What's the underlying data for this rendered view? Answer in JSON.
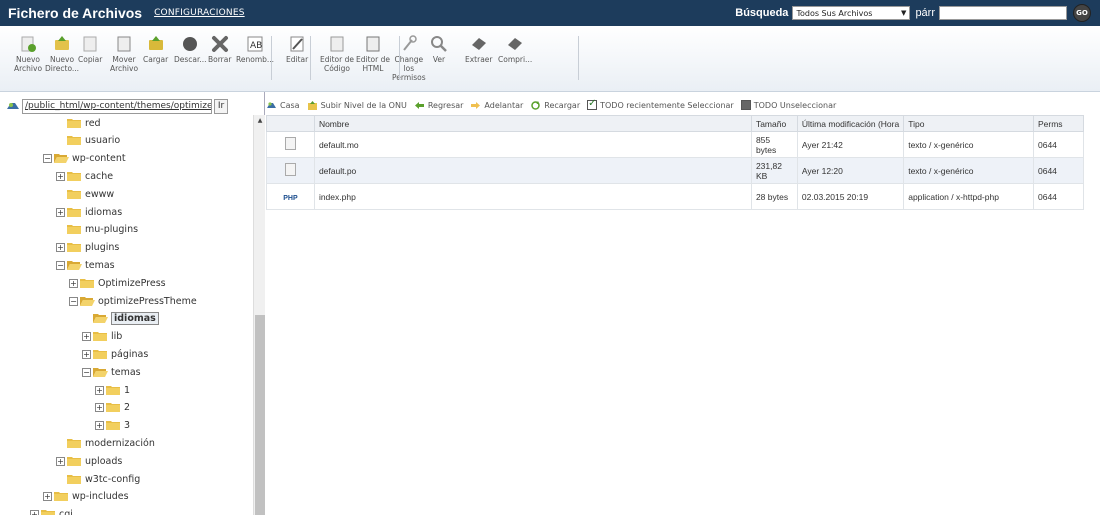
{
  "header": {
    "title": "Fichero de Archivos",
    "config_link": "CONFIGURACIONES",
    "search_label": "Búsqueda",
    "search_scope": "Todos Sus Archivos",
    "search_by_label": "párr",
    "search_value": "",
    "go_label": "GO"
  },
  "toolbar": {
    "items": [
      {
        "label": "Nuevo\nArchivo",
        "icon": "new-file-icon"
      },
      {
        "label": "Nuevo\nDirecto...",
        "icon": "new-folder-icon"
      },
      {
        "label": "Copiar",
        "icon": "copy-icon"
      },
      {
        "label": "Mover\nArchivo",
        "icon": "move-icon"
      },
      {
        "label": "Cargar",
        "icon": "upload-icon"
      },
      {
        "label": "Descar...",
        "icon": "download-icon"
      },
      {
        "label": "Borrar",
        "icon": "delete-icon"
      },
      {
        "label": "Renomb...",
        "icon": "rename-icon"
      },
      {
        "label": "Editar",
        "icon": "edit-icon"
      },
      {
        "label": "Editor de\nCódigo",
        "icon": "code-editor-icon"
      },
      {
        "label": "Editor de\nHTML",
        "icon": "html-editor-icon"
      },
      {
        "label": "Change\nlos\nPermisos",
        "icon": "permissions-icon"
      },
      {
        "label": "Ver",
        "icon": "view-icon"
      },
      {
        "label": "Extraer",
        "icon": "extract-icon"
      },
      {
        "label": "Compri...",
        "icon": "compress-icon"
      }
    ]
  },
  "path": {
    "value": "/public_html/wp-content/themes/optimize",
    "go_label": "Ir"
  },
  "tree": [
    {
      "label": "red",
      "depth": 2,
      "expander": "",
      "open": false
    },
    {
      "label": "usuario",
      "depth": 2,
      "expander": "",
      "open": false
    },
    {
      "label": "wp-content",
      "depth": 1,
      "expander": "−",
      "open": true
    },
    {
      "label": "cache",
      "depth": 2,
      "expander": "+",
      "open": false
    },
    {
      "label": "ewww",
      "depth": 2,
      "expander": "",
      "open": false
    },
    {
      "label": "idiomas",
      "depth": 2,
      "expander": "+",
      "open": false
    },
    {
      "label": "mu-plugins",
      "depth": 2,
      "expander": "",
      "open": false
    },
    {
      "label": "plugins",
      "depth": 2,
      "expander": "+",
      "open": false
    },
    {
      "label": "temas",
      "depth": 2,
      "expander": "−",
      "open": true
    },
    {
      "label": "OptimizePress",
      "depth": 3,
      "expander": "+",
      "open": false
    },
    {
      "label": "optimizePressTheme",
      "depth": 3,
      "expander": "−",
      "open": true
    },
    {
      "label": "idiomas",
      "depth": 4,
      "expander": "",
      "open": true,
      "selected": true
    },
    {
      "label": "lib",
      "depth": 4,
      "expander": "+",
      "open": false
    },
    {
      "label": "páginas",
      "depth": 4,
      "expander": "+",
      "open": false
    },
    {
      "label": "temas",
      "depth": 4,
      "expander": "−",
      "open": true
    },
    {
      "label": "1",
      "depth": 5,
      "expander": "+",
      "open": false
    },
    {
      "label": "2",
      "depth": 5,
      "expander": "+",
      "open": false
    },
    {
      "label": "3",
      "depth": 5,
      "expander": "+",
      "open": false
    },
    {
      "label": "modernización",
      "depth": 2,
      "expander": "",
      "open": false
    },
    {
      "label": "uploads",
      "depth": 2,
      "expander": "+",
      "open": false
    },
    {
      "label": "w3tc-config",
      "depth": 2,
      "expander": "",
      "open": false
    },
    {
      "label": "wp-includes",
      "depth": 1,
      "expander": "+",
      "open": false
    },
    {
      "label": "cgi",
      "depth": 0,
      "expander": "+",
      "open": false
    }
  ],
  "actions": {
    "home": "Casa",
    "up": "Subir Nivel de la ONU",
    "back": "Regresar",
    "forward": "Adelantar",
    "reload": "Recargar",
    "select_all": "TODO recientemente Seleccionar",
    "unselect_all": "TODO Unseleccionar"
  },
  "table": {
    "columns": [
      "Nombre",
      "Tamaño",
      "Última modificación (Hora",
      "Tipo",
      "Perms"
    ],
    "rows": [
      {
        "icon": "text-file-icon",
        "name": "default.mo",
        "size": "855\nbytes",
        "modified": "Ayer 21:42",
        "type": "texto / x-genérico",
        "perms": "0644"
      },
      {
        "icon": "text-file-icon",
        "name": "default.po",
        "size": "231,82\nKB",
        "modified": "Ayer 12:20",
        "type": "texto / x-genérico",
        "perms": "0644"
      },
      {
        "icon": "php-file-icon",
        "name": "index.php",
        "size": "28 bytes",
        "modified": "02.03.2015 20:19",
        "type": "application / x-httpd-php",
        "perms": "0644"
      }
    ]
  }
}
